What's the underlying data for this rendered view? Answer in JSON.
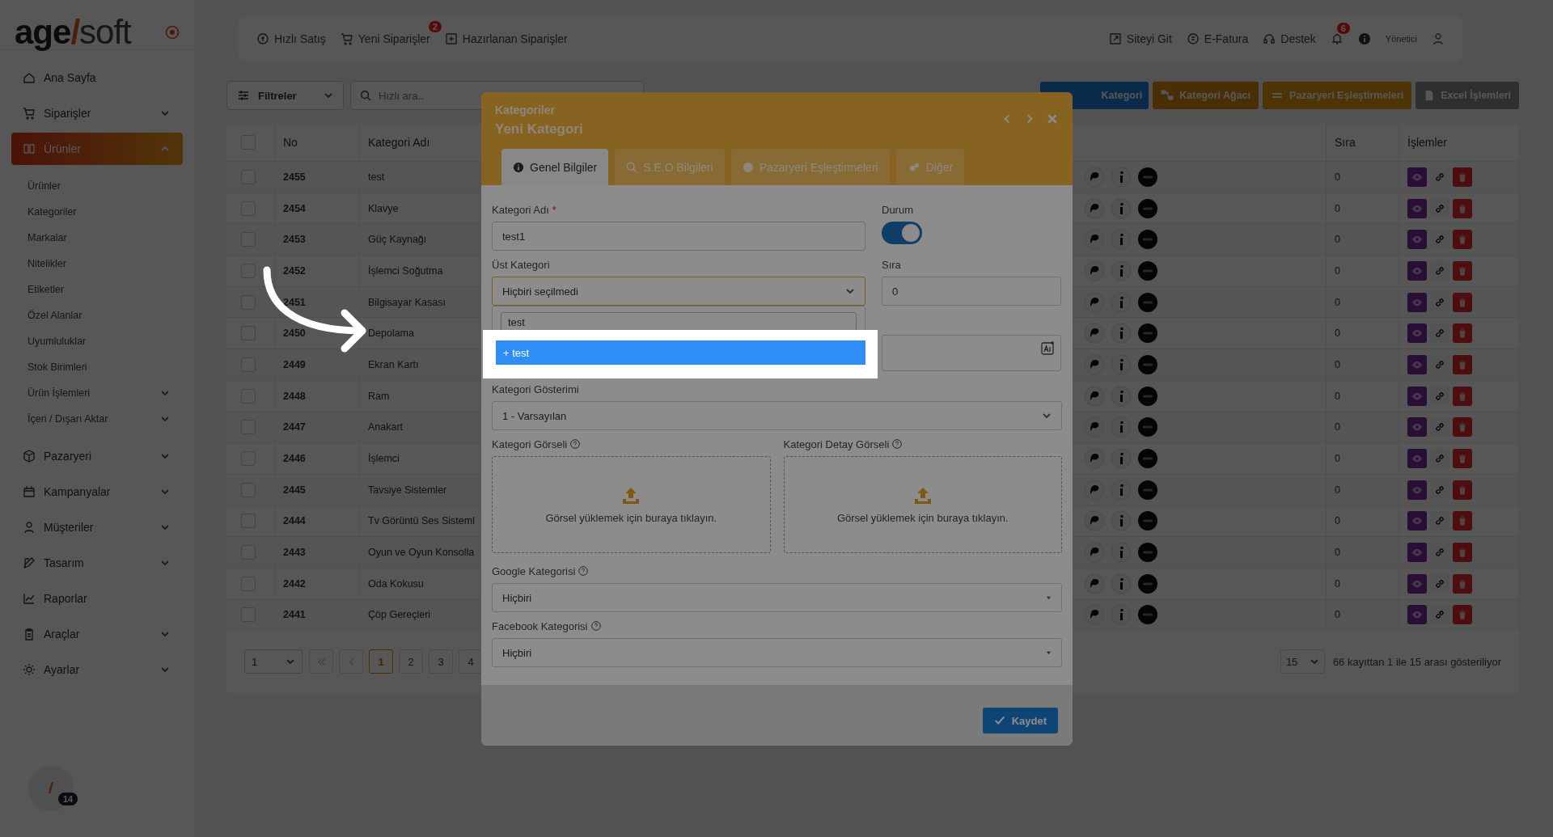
{
  "sidebar": {
    "logo": [
      {
        "text": "age",
        "kind": "bold"
      },
      {
        "text": "/",
        "kind": "slash"
      },
      {
        "text": "soft",
        "kind": "light"
      }
    ],
    "items": [
      {
        "label": "Ana Sayfa",
        "selected": false
      },
      {
        "label": "Siparişler",
        "selected": false,
        "expanded": false
      },
      {
        "label": "Ürünler",
        "selected": true,
        "expanded": true,
        "children": [
          {
            "label": "Ürünler"
          },
          {
            "label": "Kategoriler"
          },
          {
            "label": "Markalar"
          },
          {
            "label": "Nitelikler"
          },
          {
            "label": "Etiketler"
          },
          {
            "label": "Özel Alanlar"
          },
          {
            "label": "Uyumluluklar"
          },
          {
            "label": "Stok Birimleri"
          },
          {
            "label": "Ürün İşlemleri",
            "expanded": false
          },
          {
            "label": "İçeri / Dışarı Aktar",
            "expanded": false
          }
        ]
      },
      {
        "label": "Pazaryeri",
        "selected": false,
        "expanded": false
      },
      {
        "label": "Kampanyalar",
        "selected": false,
        "expanded": false
      },
      {
        "label": "Müşteriler",
        "selected": false,
        "expanded": false
      },
      {
        "label": "Tasarım",
        "selected": false,
        "expanded": false
      },
      {
        "label": "Raporlar",
        "selected": false
      },
      {
        "label": "Araçlar",
        "selected": false,
        "expanded": false
      },
      {
        "label": "Ayarlar",
        "selected": false,
        "expanded": false
      }
    ],
    "help_badge": "14"
  },
  "topbar": {
    "left": [
      {
        "label": "Hızlı Satış"
      },
      {
        "label": "Yeni Siparişler",
        "badge": "2"
      },
      {
        "label": "Hazırlanan Siparişler"
      }
    ],
    "right": [
      {
        "label": "Siteyi Git"
      },
      {
        "label": "E-Fatura"
      },
      {
        "label": "Destek"
      }
    ],
    "notifications_badge": "6",
    "user": "Yönetici"
  },
  "toolbar": {
    "filter": "Filtreler",
    "search": {
      "placeholder": "Hızlı ara.."
    },
    "buttons": [
      {
        "label": "Kategori",
        "kind": "primary"
      },
      {
        "label": "Kategori Ağacı",
        "kind": "tree"
      },
      {
        "label": "Pazaryeri Eşleştirmeleri",
        "kind": "market"
      },
      {
        "label": "Excel İşlemleri",
        "kind": "excel"
      }
    ]
  },
  "table": {
    "all_checked": false,
    "columns": [
      "No",
      "Kategori Adı",
      "Sıra",
      "İşlemler"
    ],
    "rows": [
      {
        "no": "2455",
        "name": "test",
        "sira": "0",
        "checked": false
      },
      {
        "no": "2454",
        "name": "Klavye",
        "sira": "0",
        "checked": false
      },
      {
        "no": "2453",
        "name": "Güç Kaynağı",
        "sira": "0",
        "checked": false
      },
      {
        "no": "2452",
        "name": "İşlemci Soğutma",
        "sira": "0",
        "checked": false
      },
      {
        "no": "2451",
        "name": "Bilgisayar Kasası",
        "sira": "0",
        "checked": false
      },
      {
        "no": "2450",
        "name": "Depolama",
        "sira": "0",
        "checked": false
      },
      {
        "no": "2449",
        "name": "Ekran Kartı",
        "sira": "0",
        "checked": false
      },
      {
        "no": "2448",
        "name": "Ram",
        "sira": "0",
        "checked": false
      },
      {
        "no": "2447",
        "name": "Anakart",
        "sira": "0",
        "checked": false
      },
      {
        "no": "2446",
        "name": "İşlemci",
        "sira": "0",
        "checked": false
      },
      {
        "no": "2445",
        "name": "Tavsiye Sistemler",
        "sira": "0",
        "checked": false
      },
      {
        "no": "2444",
        "name": "Tv Görüntü Ses Sisteml",
        "sira": "0",
        "checked": false
      },
      {
        "no": "2443",
        "name": "Oyun ve Oyun Konsolla",
        "sira": "0",
        "checked": false
      },
      {
        "no": "2442",
        "name": "Oda Kokusu",
        "sira": "0",
        "checked": false
      },
      {
        "no": "2441",
        "name": "Çöp Gereçleri",
        "sira": "0",
        "checked": false
      }
    ]
  },
  "pagination": {
    "page_select": "1",
    "pages": [
      {
        "label": "1",
        "selected": true
      },
      {
        "label": "2",
        "selected": false
      },
      {
        "label": "3",
        "selected": false
      },
      {
        "label": "4",
        "selected": false
      }
    ],
    "per_page": "15",
    "info": "66 kayıttan 1 ile 15 arası gösteriliyor"
  },
  "modal": {
    "title": "Kategoriler",
    "subtitle": "Yeni Kategori",
    "tabs": [
      {
        "label": "Genel Bilgiler",
        "selected": true
      },
      {
        "label": "S.E.O Bilgileri",
        "selected": false
      },
      {
        "label": "Pazaryeri Eşleştirmeleri",
        "selected": false
      },
      {
        "label": "Diğer",
        "selected": false
      }
    ],
    "name_label": "Kategori Adı",
    "name_required": "*",
    "name_value": "test1",
    "status_label": "Durum",
    "status_on": true,
    "parent_label": "Üst Kategori",
    "parent_value": "Hiçbiri seçilmedi",
    "order_label": "Sıra",
    "order_value": "0",
    "dropdown": {
      "search_value": "test",
      "options": [
        {
          "label": "+ test",
          "selected": true
        }
      ]
    },
    "display_label": "Kategori Gösterimi",
    "display_value": "1 - Varsayılan",
    "image_label": "Kategori Görseli",
    "detail_image_label": "Kategori Detay Görseli",
    "upload_text": [
      "Görsel yüklemek için buraya tıklayın.",
      "Görsel yüklemek için buraya tıklayın."
    ],
    "google_label": "Google Kategorisi",
    "google_value": "Hiçbiri",
    "facebook_label": "Facebook Kategorisi",
    "facebook_value": "Hiçbiri",
    "save": "Kaydet"
  }
}
